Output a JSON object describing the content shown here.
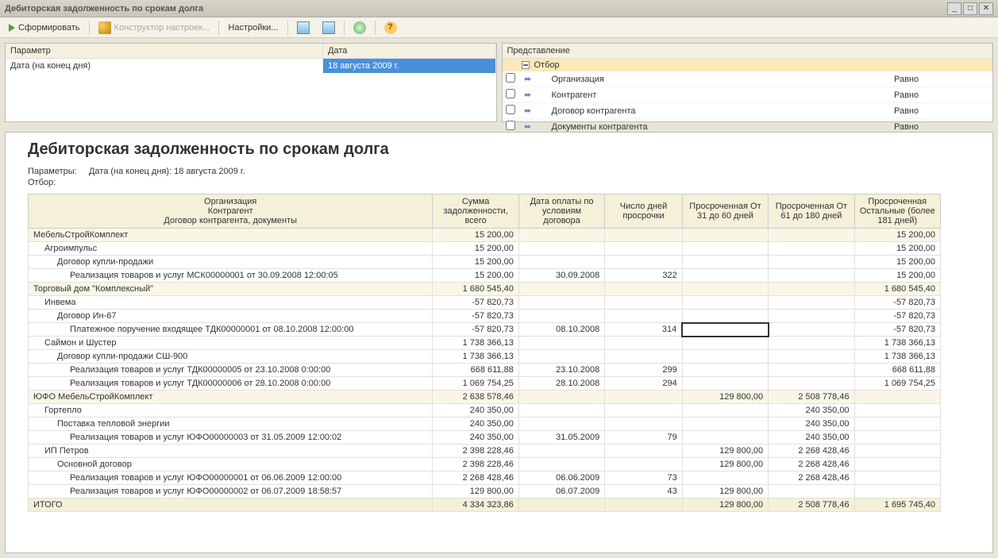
{
  "window_title": "Дебиторская задолженность по срокам долга",
  "toolbar": {
    "generate": "Сформировать",
    "settings_builder": "Конструктор настроек...",
    "settings": "Настройки..."
  },
  "params_header": {
    "param": "Параметр",
    "date": "Дата"
  },
  "params_row": {
    "param": "Дата (на конец дня)",
    "date": "18 августа 2009 г."
  },
  "filter_header": "Представление",
  "filter_top": "Отбор",
  "filters": [
    {
      "label": "Организация",
      "cond": "Равно"
    },
    {
      "label": "Контрагент",
      "cond": "Равно"
    },
    {
      "label": "Договор контрагента",
      "cond": "Равно"
    },
    {
      "label": "Документы контрагента",
      "cond": "Равно"
    }
  ],
  "report": {
    "title": "Дебиторская задолженность по срокам долга",
    "params_label": "Параметры:",
    "params_text": "Дата (на конец дня): 18 августа 2009 г.",
    "filter_label": "Отбор:",
    "columns": {
      "org": "Организация",
      "counterparty": "Контрагент",
      "contract": "Договор контрагента, документы",
      "sum": "Сумма задолженности, всего",
      "paydate": "Дата оплаты по условиям договора",
      "overdue_days": "Число дней просрочки",
      "o31_60": "Просроченная От 31 до 60 дней",
      "o61_180": "Просроченная От 61 до 180 дней",
      "other": "Просроченная Остальные (более 181 дней)"
    },
    "rows": [
      {
        "lvl": 0,
        "name": "МебельСтройКомплект",
        "sum": "15 200,00",
        "pay": "",
        "days": "",
        "c1": "",
        "c2": "",
        "c3": "15 200,00"
      },
      {
        "lvl": 1,
        "name": "Агроимпульс",
        "sum": "15 200,00",
        "pay": "",
        "days": "",
        "c1": "",
        "c2": "",
        "c3": "15 200,00"
      },
      {
        "lvl": 2,
        "name": "Договор купли-продажи",
        "sum": "15 200,00",
        "pay": "",
        "days": "",
        "c1": "",
        "c2": "",
        "c3": "15 200,00"
      },
      {
        "lvl": 3,
        "name": "Реализация товаров и услуг МСК00000001 от 30.09.2008 12:00:05",
        "sum": "15 200,00",
        "pay": "30.09.2008",
        "days": "322",
        "c1": "",
        "c2": "",
        "c3": "15 200,00"
      },
      {
        "lvl": 0,
        "name": "Торговый дом \"Комплексный\"",
        "sum": "1 680 545,40",
        "pay": "",
        "days": "",
        "c1": "",
        "c2": "",
        "c3": "1 680 545,40"
      },
      {
        "lvl": 1,
        "name": "Инвема",
        "sum": "-57 820,73",
        "pay": "",
        "days": "",
        "c1": "",
        "c2": "",
        "c3": "-57 820,73"
      },
      {
        "lvl": 2,
        "name": "Договор Ин-67",
        "sum": "-57 820,73",
        "pay": "",
        "days": "",
        "c1": "",
        "c2": "",
        "c3": "-57 820,73"
      },
      {
        "lvl": 3,
        "name": "Платежное поручение входящее ТДК00000001 от 08.10.2008 12:00:00",
        "sum": "-57 820,73",
        "pay": "08.10.2008",
        "days": "314",
        "c1": "",
        "c2": "",
        "c3": "-57 820,73",
        "sel": true
      },
      {
        "lvl": 1,
        "name": "Саймон и Шустер",
        "sum": "1 738 366,13",
        "pay": "",
        "days": "",
        "c1": "",
        "c2": "",
        "c3": "1 738 366,13"
      },
      {
        "lvl": 2,
        "name": "Договор купли-продажи СШ-900",
        "sum": "1 738 366,13",
        "pay": "",
        "days": "",
        "c1": "",
        "c2": "",
        "c3": "1 738 366,13"
      },
      {
        "lvl": 3,
        "name": "Реализация товаров и услуг ТДК00000005 от 23.10.2008 0:00:00",
        "sum": "668 611,88",
        "pay": "23.10.2008",
        "days": "299",
        "c1": "",
        "c2": "",
        "c3": "668 611,88"
      },
      {
        "lvl": 3,
        "name": "Реализация товаров и услуг ТДК00000006 от 28.10.2008 0:00:00",
        "sum": "1 069 754,25",
        "pay": "28.10.2008",
        "days": "294",
        "c1": "",
        "c2": "",
        "c3": "1 069 754,25"
      },
      {
        "lvl": 0,
        "name": "ЮФО МебельСтройКомплект",
        "sum": "2 638 578,46",
        "pay": "",
        "days": "",
        "c1": "129 800,00",
        "c2": "2 508 778,46",
        "c3": ""
      },
      {
        "lvl": 1,
        "name": "Гортепло",
        "sum": "240 350,00",
        "pay": "",
        "days": "",
        "c1": "",
        "c2": "240 350,00",
        "c3": ""
      },
      {
        "lvl": 2,
        "name": "Поставка тепловой энергии",
        "sum": "240 350,00",
        "pay": "",
        "days": "",
        "c1": "",
        "c2": "240 350,00",
        "c3": ""
      },
      {
        "lvl": 3,
        "name": "Реализация товаров и услуг ЮФО00000003 от 31.05.2009 12:00:02",
        "sum": "240 350,00",
        "pay": "31.05.2009",
        "days": "79",
        "c1": "",
        "c2": "240 350,00",
        "c3": ""
      },
      {
        "lvl": 1,
        "name": "ИП Петров",
        "sum": "2 398 228,46",
        "pay": "",
        "days": "",
        "c1": "129 800,00",
        "c2": "2 268 428,46",
        "c3": ""
      },
      {
        "lvl": 2,
        "name": "Основной договор",
        "sum": "2 398 228,46",
        "pay": "",
        "days": "",
        "c1": "129 800,00",
        "c2": "2 268 428,46",
        "c3": ""
      },
      {
        "lvl": 3,
        "name": "Реализация товаров и услуг ЮФО00000001 от 06.06.2009 12:00:00",
        "sum": "2 268 428,46",
        "pay": "06.06.2009",
        "days": "73",
        "c1": "",
        "c2": "2 268 428,46",
        "c3": ""
      },
      {
        "lvl": 3,
        "name": "Реализация товаров и услуг ЮФО00000002 от 06.07.2009 18:58:57",
        "sum": "129 800,00",
        "pay": "06.07.2009",
        "days": "43",
        "c1": "129 800,00",
        "c2": "",
        "c3": ""
      }
    ],
    "total": {
      "name": "ИТОГО",
      "sum": "4 334 323,86",
      "c1": "129 800,00",
      "c2": "2 508 778,46",
      "c3": "1 695 745,40"
    }
  }
}
